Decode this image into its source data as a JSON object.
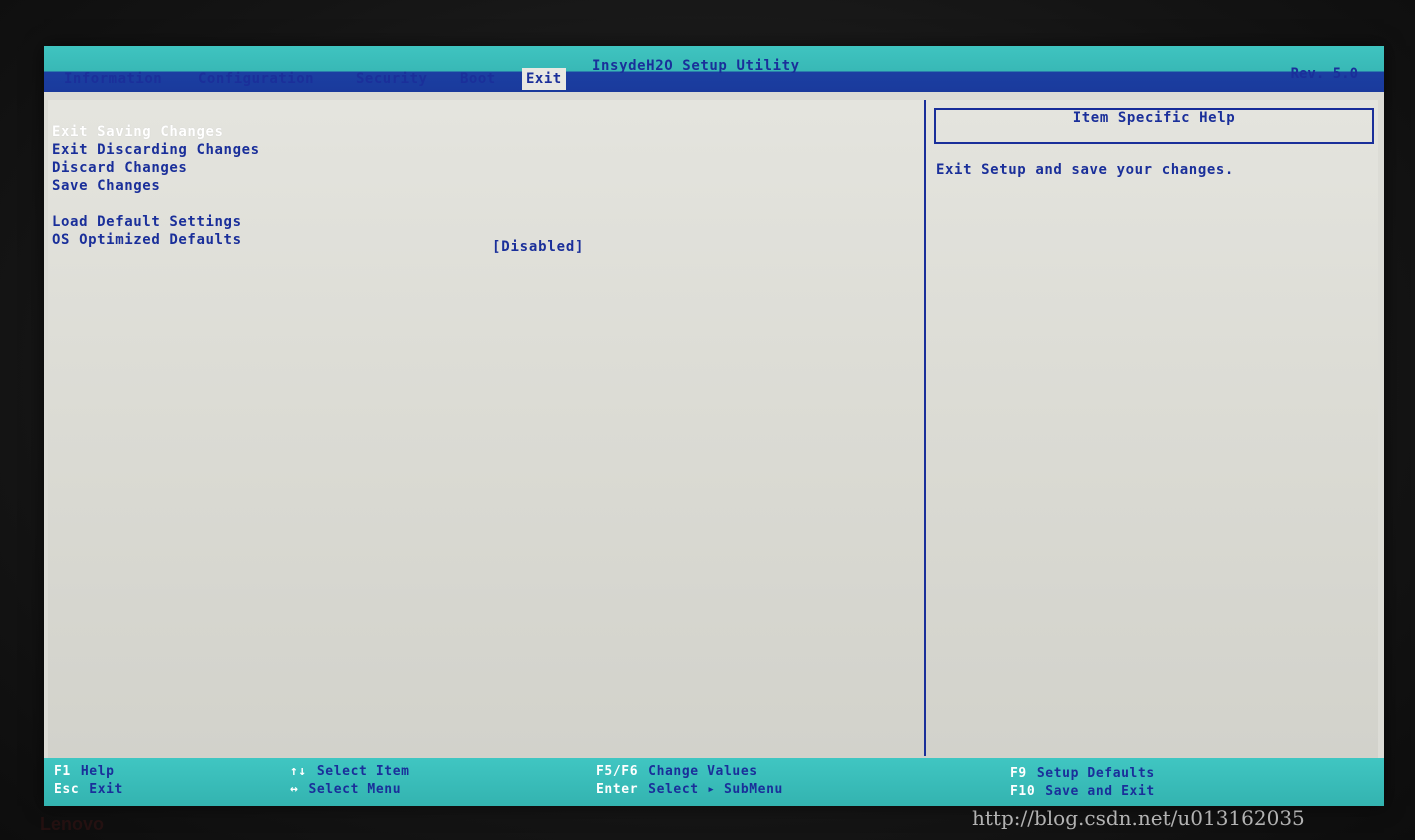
{
  "header": {
    "utility_title": "InsydeH2O Setup Utility",
    "revision": "Rev. 5.0",
    "tabs": [
      {
        "label": "Information",
        "active": false
      },
      {
        "label": "Configuration",
        "active": false
      },
      {
        "label": "Security",
        "active": false
      },
      {
        "label": "Boot",
        "active": false
      },
      {
        "label": "Exit",
        "active": true
      }
    ]
  },
  "menu": {
    "items": [
      {
        "label": "Exit Saving Changes",
        "selected": true
      },
      {
        "label": "Exit Discarding Changes",
        "selected": false
      },
      {
        "label": "Discard Changes",
        "selected": false
      },
      {
        "label": "Save Changes",
        "selected": false
      },
      {
        "label": "Load Default Settings",
        "selected": false
      },
      {
        "label": "OS Optimized Defaults",
        "selected": false,
        "value": "[Disabled]"
      }
    ]
  },
  "help": {
    "title": "Item Specific Help",
    "text": "Exit Setup and save your changes."
  },
  "footer": {
    "keys": [
      {
        "key": "F1",
        "desc": "Help"
      },
      {
        "key": "Esc",
        "desc": "Exit"
      },
      {
        "key": "↑↓",
        "desc": "Select Item"
      },
      {
        "key": "↔",
        "desc": "Select Menu"
      },
      {
        "key": "F5/F6",
        "desc": "Change Values"
      },
      {
        "key": "Enter",
        "desc": "Select ▸ SubMenu"
      },
      {
        "key": "F9",
        "desc": "Setup Defaults"
      },
      {
        "key": "F10",
        "desc": "Save and Exit"
      }
    ]
  },
  "watermark": "http://blog.csdn.net/u013162035",
  "brand": "Lenovo",
  "colors": {
    "bar_teal": "#3fc4c0",
    "text_blue": "#1a2f9a",
    "panel_bg": "#dcdcd6",
    "selected_text": "#ffffff"
  }
}
